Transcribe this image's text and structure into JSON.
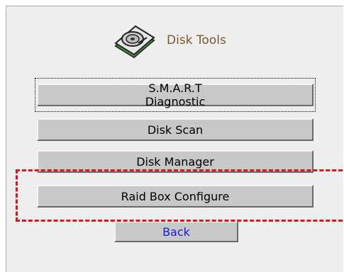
{
  "header": {
    "title": "Disk Tools",
    "icon": "hard-disk-icon"
  },
  "buttons": {
    "smart": "S.M.A.R.T Diagnostic",
    "scan": "Disk Scan",
    "manager": "Disk Manager",
    "raid": "Raid Box Configure",
    "back": "Back"
  },
  "colors": {
    "title": "#7a5a2a",
    "back_text": "#1a1ad6",
    "highlight_dash": "#e0141c",
    "panel_bg": "#eeeeee",
    "button_bg": "#c8c8c8"
  }
}
